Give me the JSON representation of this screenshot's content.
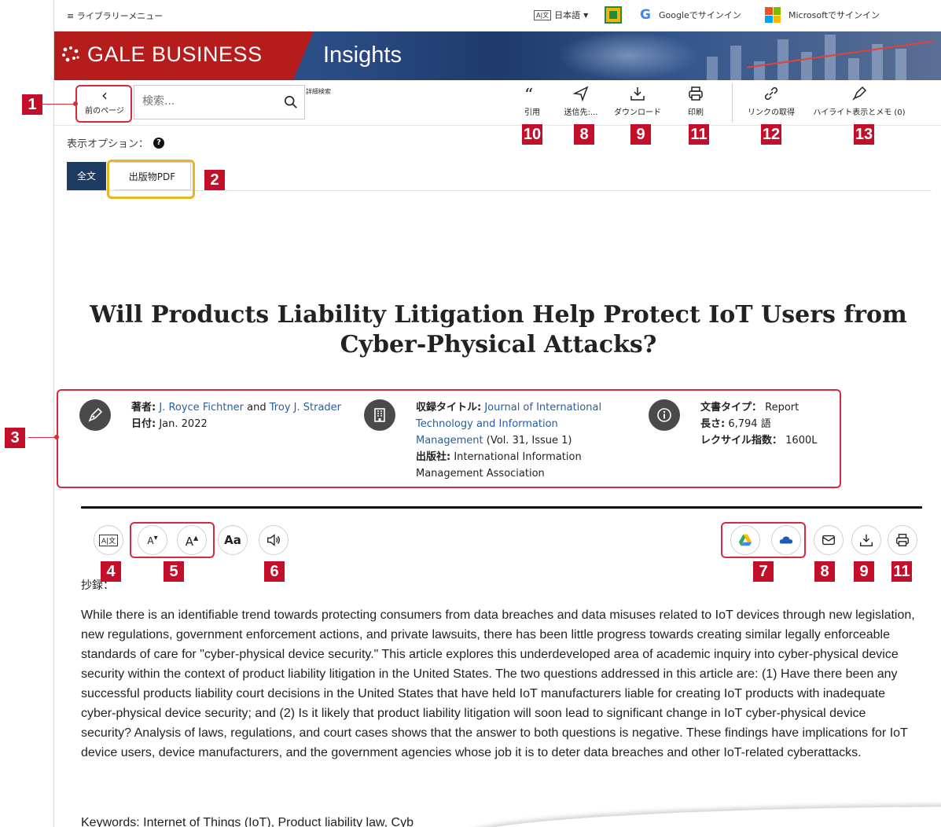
{
  "topbar": {
    "library_menu": "≡ ライブラリーメニュー",
    "language_icon": "A|文",
    "language": "日本語",
    "google_signin": "Googleでサインイン",
    "microsoft_signin": "Microsoftでサインイン"
  },
  "banner": {
    "brand": "GALE BUSINESS",
    "product": "Insights"
  },
  "toolbar": {
    "prev_page": "前のページ",
    "search_placeholder": "検索...",
    "advanced_search": "詳細検索",
    "cite": "引用",
    "send_to": "送信先:...",
    "download": "ダウンロード",
    "print": "印刷",
    "get_link": "リンクの取得",
    "highlights": "ハイライト表示とメモ (0)"
  },
  "display_options": "表示オプション：",
  "tabs": {
    "full_text": "全文",
    "pdf": "出版物PDF"
  },
  "article": {
    "title": "Will Products Liability Litigation Help Protect IoT Users from Cyber-Physical Attacks?",
    "author_label": "著者:",
    "author_1": "J. Royce Fichtner",
    "author_and": "and",
    "author_2": "Troy J. Strader",
    "date_label": "日付:",
    "date": "Jan. 2022",
    "source_label": "収録タイトル:",
    "source_title": "Journal of International Technology and Information Management",
    "source_issue": "(Vol. 31, Issue 1)",
    "publisher_label": "出版社:",
    "publisher": "International Information Management Association",
    "doctype_label": "文書タイプ：",
    "doctype": "Report",
    "length_label": "長さ:",
    "length": "6,794 語",
    "lexile_label": "レクサイル指数：",
    "lexile": "1600L"
  },
  "reader_tools": {
    "translate_icon": "A|文",
    "font_down": "A",
    "font_up": "A",
    "font_style": "Aa"
  },
  "abstract_label": "抄録：",
  "abstract": "While there is an identifiable trend towards protecting consumers from data breaches and data misuses related to IoT devices through new legislation, new regulations, government enforcement actions, and private lawsuits, there has been little progress towards creating similar legally enforceable standards of care for \"cyber-physical device security.\" This article explores this underdeveloped area of academic inquiry into cyber-physical device security within the context of product liability litigation in the United States. The two questions addressed in this article are: (1) Have there been any successful products liability court decisions in the United States that have held IoT manufacturers liable for creating IoT products with inadequate cyber-physical device security; and (2) Is it likely that product liability litigation will soon lead to significant change in IoT cyber-physical device security? Analysis of laws, regulations, and court cases shows that the answer to both questions is negative. These findings have implications for IoT device users, device manufacturers, and the government agencies whose job it is to deter data breaches and other IoT-related cyberattacks.",
  "keywords": "Keywords: Internet of Things (IoT), Product liability law, Cyb",
  "callouts": [
    "1",
    "2",
    "3",
    "4",
    "5",
    "6",
    "7",
    "8",
    "9",
    "11",
    "10",
    "8",
    "9",
    "11",
    "12",
    "13"
  ],
  "colors": {
    "callout_red": "#c40f2a",
    "tab_navy": "#1d3a63",
    "link_blue": "#2a5d9f",
    "highlight_yellow": "#e6b71f"
  }
}
